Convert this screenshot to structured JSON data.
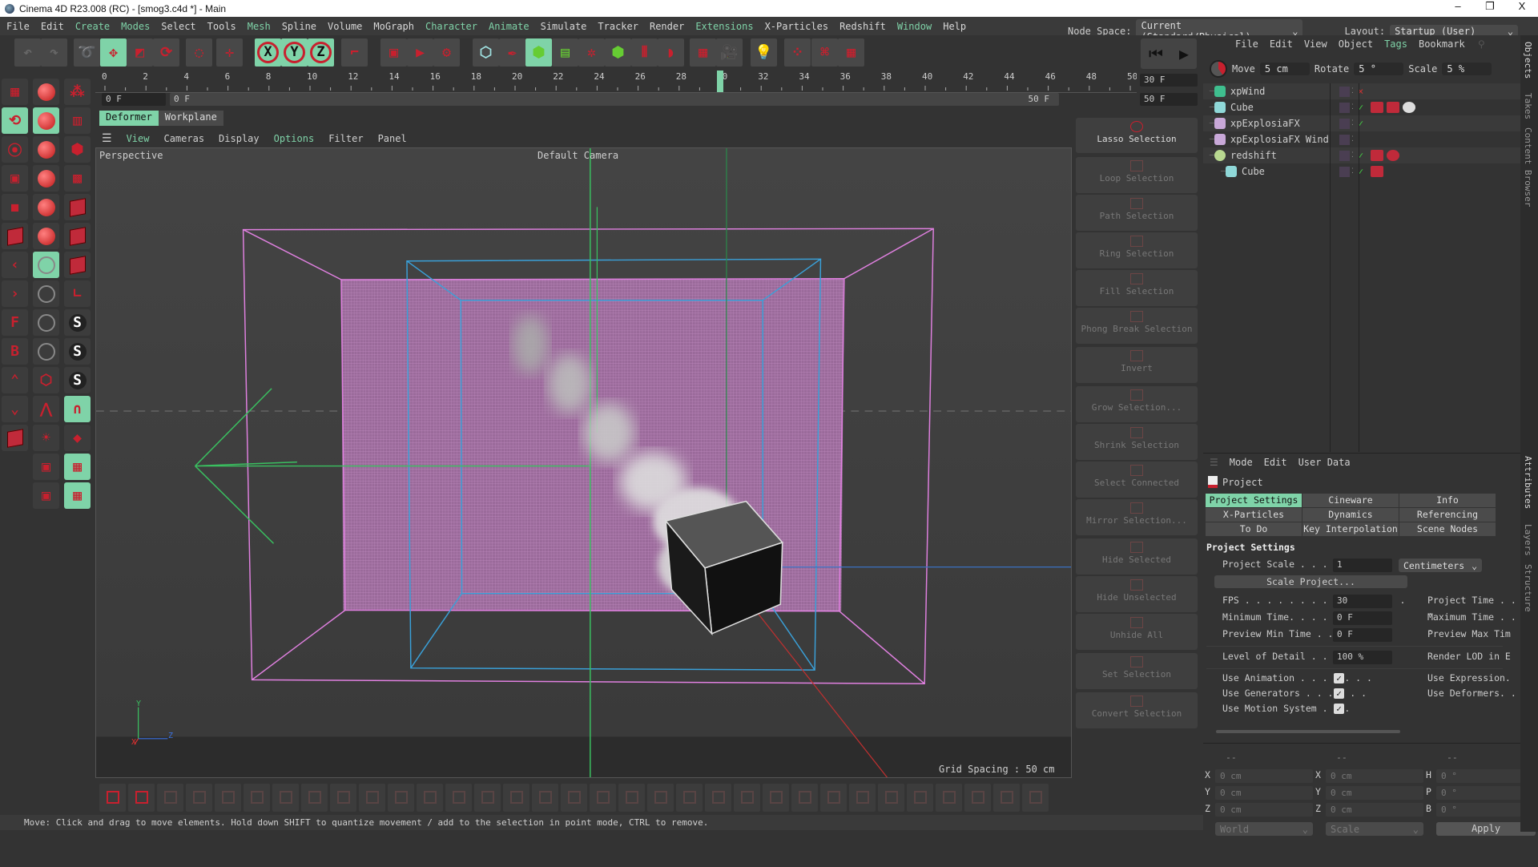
{
  "window": {
    "title": "Cinema 4D R23.008 (RC) - [smog3.c4d *] - Main",
    "controls": [
      "–",
      "❐",
      "X"
    ]
  },
  "menu": [
    {
      "label": "File"
    },
    {
      "label": "Edit"
    },
    {
      "label": "Create",
      "accent": true
    },
    {
      "label": "Modes",
      "accent": true
    },
    {
      "label": "Select"
    },
    {
      "label": "Tools"
    },
    {
      "label": "Mesh",
      "accent": true
    },
    {
      "label": "Spline"
    },
    {
      "label": "Volume"
    },
    {
      "label": "MoGraph"
    },
    {
      "label": "Character",
      "accent": true
    },
    {
      "label": "Animate",
      "accent": true
    },
    {
      "label": "Simulate"
    },
    {
      "label": "Tracker"
    },
    {
      "label": "Render"
    },
    {
      "label": "Extensions",
      "accent": true
    },
    {
      "label": "X-Particles"
    },
    {
      "label": "Redshift"
    },
    {
      "label": "Window",
      "accent": true
    },
    {
      "label": "Help"
    }
  ],
  "nodespace": {
    "label": "Node Space:",
    "value": "Current (Standard/Physical)",
    "layout_label": "Layout:",
    "layout_value": "Startup (User)"
  },
  "toolbar": {
    "axis": [
      "X",
      "Y",
      "Z"
    ],
    "icons": [
      "undo-icon",
      "redo-icon",
      "live-selection-icon",
      "move-icon",
      "scale-icon",
      "rotate-icon",
      "psr-icon",
      "world-axis-icon",
      "x-axis-icon",
      "y-axis-icon",
      "z-axis-icon",
      "coordinate-system-icon",
      "render-view-icon",
      "render-picture-viewer-icon",
      "render-settings-icon",
      "cube-icon",
      "pen-icon",
      "subdivision-icon",
      "extrude-icon",
      "cloner-icon",
      "mograph-icon",
      "symmetry-icon",
      "deformer-icon",
      "floor-icon",
      "camera-icon",
      "light-icon",
      "xp-system-icon",
      "xp-emitter-icon",
      "xp-cache-icon"
    ]
  },
  "timeline": {
    "ticks": [
      "0",
      "2",
      "4",
      "6",
      "8",
      "10",
      "12",
      "14",
      "16",
      "18",
      "20",
      "22",
      "24",
      "26",
      "28",
      "30",
      "32",
      "34",
      "36",
      "38",
      "40",
      "42",
      "44",
      "46",
      "48",
      "50"
    ],
    "current_frame": 30,
    "current_field": "30 F",
    "start": "0 F",
    "start2": "0 F",
    "end": "50 F",
    "end2": "50 F"
  },
  "viewport": {
    "tabs": [
      {
        "label": "Deformer",
        "active": true
      },
      {
        "label": "Workplane"
      }
    ],
    "menu": [
      {
        "label": "View",
        "accent": true
      },
      {
        "label": "Cameras"
      },
      {
        "label": "Display"
      },
      {
        "label": "Options",
        "accent": true
      },
      {
        "label": "Filter"
      },
      {
        "label": "Panel"
      }
    ],
    "view_name": "Perspective",
    "camera": "Default Camera",
    "grid_spacing": "Grid Spacing : 50 cm",
    "axis_labels": [
      "Y",
      "Z",
      "X"
    ]
  },
  "selection_panel": [
    "Lasso Selection",
    "Loop Selection",
    "Path Selection",
    "Ring Selection",
    "Fill Selection",
    "Phong Break Selection",
    "Invert",
    "Grow Selection...",
    "Shrink Selection",
    "Select Connected",
    "Mirror Selection...",
    "Hide Selected",
    "Hide Unselected",
    "Unhide All",
    "Set Selection",
    "Convert Selection"
  ],
  "object_manager": {
    "menu": [
      {
        "label": "File"
      },
      {
        "label": "Edit"
      },
      {
        "label": "View"
      },
      {
        "label": "Object"
      },
      {
        "label": "Tags",
        "accent": true
      },
      {
        "label": "Bookmark"
      }
    ],
    "move_label": "Move",
    "move": "5 cm",
    "rotate_label": "Rotate",
    "rotate": "5 °",
    "scale_label": "Scale",
    "scale": "5 %",
    "objects": [
      {
        "name": "xpWind",
        "icon": "xp-wind-icon",
        "color": "#3fbf8f",
        "enabled": false,
        "indent": 0
      },
      {
        "name": "Cube",
        "icon": "cube-icon",
        "color": "#8fd8d8",
        "enabled": true,
        "indent": 0,
        "tags": [
          "display-tag-icon",
          "material-tag-icon",
          "xp-explosia-tag-icon"
        ]
      },
      {
        "name": "xpExplosiaFX",
        "icon": "xp-explosia-icon",
        "color": "#c8a8d8",
        "enabled": true,
        "indent": 0
      },
      {
        "name": "xpExplosiaFX Wind",
        "icon": "xp-explosia-wind-icon",
        "color": "#c8a8d8",
        "enabled": null,
        "indent": 0
      },
      {
        "name": "redshift",
        "icon": "redshift-sphere-icon",
        "color": "#b8d890",
        "enabled": true,
        "indent": 0,
        "tags": [
          "redshift-tag-icon",
          "material-ball-icon"
        ]
      },
      {
        "name": "Cube",
        "icon": "cube-icon",
        "color": "#8fd8d8",
        "enabled": true,
        "indent": 1,
        "tags": [
          "material-tag-icon"
        ]
      }
    ]
  },
  "attributes": {
    "menu": [
      "Mode",
      "Edit",
      "User Data"
    ],
    "object": "Project",
    "tabs": [
      {
        "label": "Project Settings",
        "active": true
      },
      {
        "label": "Cineware"
      },
      {
        "label": "Info"
      },
      {
        "label": "X-Particles"
      },
      {
        "label": "Dynamics"
      },
      {
        "label": "Referencing"
      },
      {
        "label": "To Do"
      },
      {
        "label": "Key Interpolation"
      },
      {
        "label": "Scene Nodes"
      }
    ],
    "section": "Project Settings",
    "project_scale_label": "Project Scale . . . . . . .",
    "project_scale": "1",
    "unit": "Centimeters",
    "scale_project_button": "Scale Project...",
    "fields": [
      {
        "label": "FPS . . . . . . . . . . . . . . .",
        "value": "30",
        "right": "Project Time . . ."
      },
      {
        "label": "Minimum Time. . . . . . . .",
        "value": "0 F",
        "right": "Maximum Time . . ."
      },
      {
        "label": "Preview Min Time . . . .",
        "value": "0 F",
        "right": "Preview Max Tim"
      },
      {
        "label": "Level of Detail . . . . .",
        "value": "100 %",
        "right": "Render LOD in E"
      }
    ],
    "checks": [
      {
        "label": "Use Animation . . . . . . .",
        "checked": true,
        "right": "Use Expression."
      },
      {
        "label": "Use Generators . . . . . .",
        "checked": true,
        "right": "Use Deformers. ."
      },
      {
        "label": "Use Motion System . . .",
        "checked": true,
        "right": ""
      }
    ]
  },
  "coordinates": {
    "headers": [
      "--",
      "--",
      "--"
    ],
    "rows": [
      [
        "X",
        "0 cm",
        "X",
        "0 cm",
        "H",
        "0 °"
      ],
      [
        "Y",
        "0 cm",
        "Y",
        "0 cm",
        "P",
        "0 °"
      ],
      [
        "Z",
        "0 cm",
        "Z",
        "0 cm",
        "B",
        "0 °"
      ]
    ],
    "mode": "World",
    "type": "Scale",
    "apply": "Apply"
  },
  "side_tabs": [
    "Objects",
    "Takes",
    "Content Browser",
    "Attributes",
    "Layers",
    "Structure"
  ],
  "status": "Move: Click and drag to move elements. Hold down SHIFT to quantize movement / add to the selection in point mode, CTRL to remove.",
  "colors": {
    "accent": "#7fd3a8",
    "icon_red": "#c8202e",
    "grid_plane": "#9a6a9a",
    "bounding_box": "#e080e0",
    "camera_box": "#3aa0d8"
  }
}
